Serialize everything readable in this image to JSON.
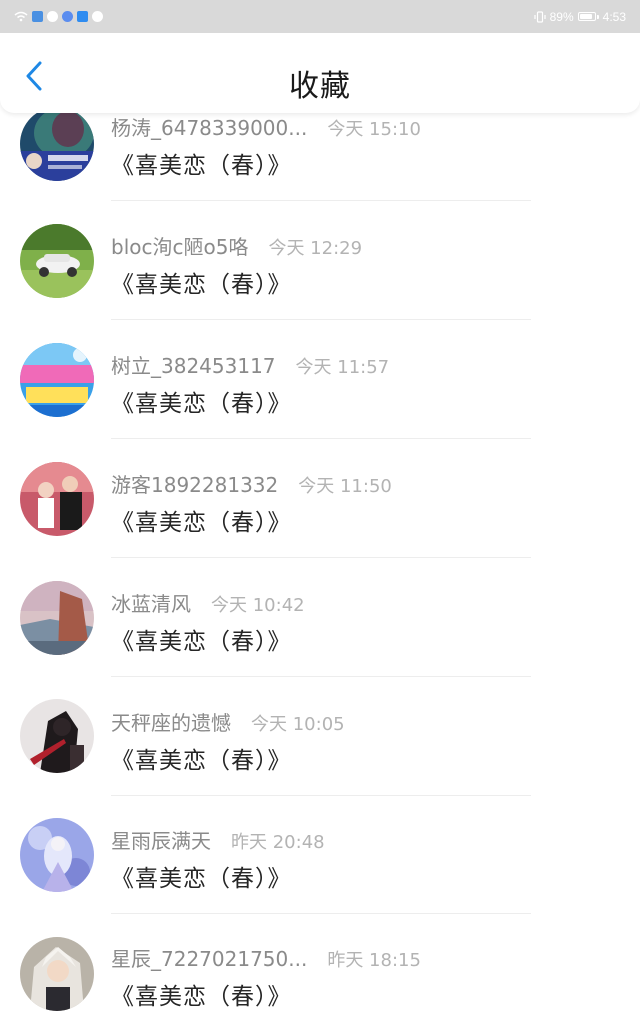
{
  "status_bar": {
    "battery": "89%",
    "time": "4:53",
    "battery_level": 0.89
  },
  "header": {
    "title": "收藏",
    "back_icon": "chevron-left-icon",
    "accent_color": "#1e88e5"
  },
  "items": [
    {
      "user": "杨涛_6478339000...",
      "time": "今天 15:10",
      "title": "《喜美恋（春）》",
      "avatar": "game-character"
    },
    {
      "user": "bloc洵c陋o5咯",
      "time": "今天 12:29",
      "title": "《喜美恋（春）》",
      "avatar": "white-car"
    },
    {
      "user": "树立_382453117",
      "time": "今天 11:57",
      "title": "《喜美恋（春）》",
      "avatar": "cartoon-banner"
    },
    {
      "user": "游客1892281332",
      "time": "今天 11:50",
      "title": "《喜美恋（春）》",
      "avatar": "couple-photo"
    },
    {
      "user": "冰蓝清风",
      "time": "今天 10:42",
      "title": "《喜美恋（春）》",
      "avatar": "sunset-rocks"
    },
    {
      "user": "天秤座的遗憾",
      "time": "今天 10:05",
      "title": "《喜美恋（春）》",
      "avatar": "dark-figure"
    },
    {
      "user": "星雨辰满天",
      "time": "昨天 20:48",
      "title": "《喜美恋（春）》",
      "avatar": "anime-girl"
    },
    {
      "user": "星辰_7227021750...",
      "time": "昨天 18:15",
      "title": "《喜美恋（春）》",
      "avatar": "anime-man"
    }
  ]
}
